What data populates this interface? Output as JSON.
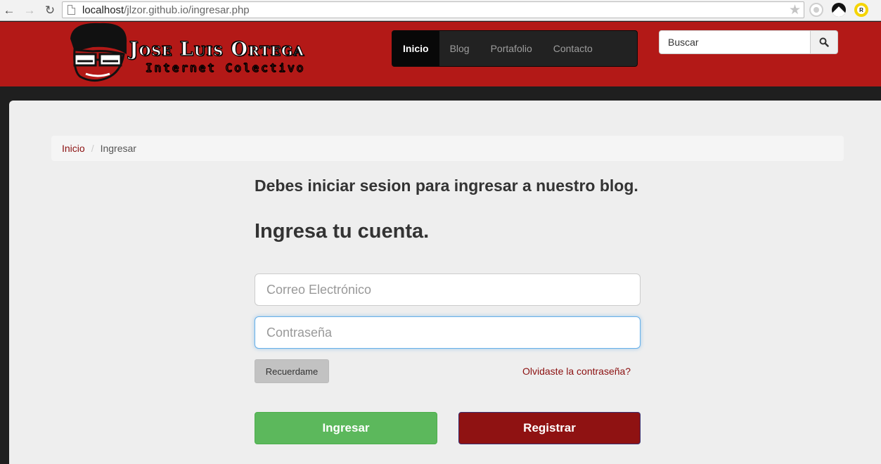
{
  "browser": {
    "url_host": "localhost",
    "url_path": "/jlzor.github.io/ingresar.php",
    "icons": [
      "back-arrow-icon",
      "forward-arrow-icon",
      "reload-icon",
      "page-icon",
      "star-icon"
    ]
  },
  "site": {
    "logo_title": "Jose Luis Ortega",
    "logo_subtitle": "Internet Colectivo",
    "brand_color": "#b31917",
    "nav": [
      {
        "label": "Inicio",
        "active": true
      },
      {
        "label": "Blog",
        "active": false
      },
      {
        "label": "Portafolio",
        "active": false
      },
      {
        "label": "Contacto",
        "active": false
      }
    ],
    "search": {
      "placeholder": "Buscar",
      "button_icon": "search-icon"
    }
  },
  "breadcrumb": {
    "home": "Inicio",
    "separator": "/",
    "current": "Ingresar"
  },
  "login": {
    "message": "Debes iniciar sesion para ingresar a nuestro blog.",
    "heading": "Ingresa tu cuenta.",
    "email_placeholder": "Correo Electrónico",
    "password_placeholder": "Contraseña",
    "remember_label": "Recuerdame",
    "forgot_label": "Olvidaste la contraseña?",
    "login_label": "Ingresar",
    "register_label": "Registrar",
    "login_color": "#5cb85c",
    "register_color": "#8f1212"
  }
}
